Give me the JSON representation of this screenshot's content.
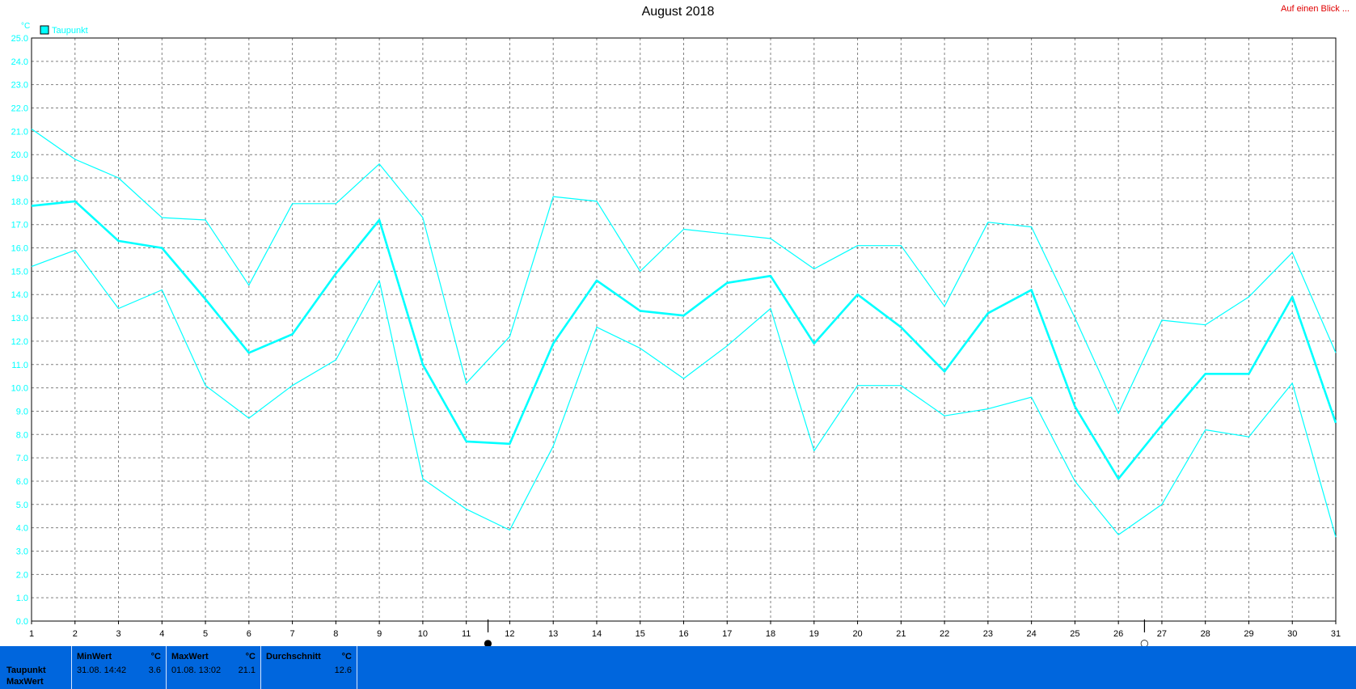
{
  "header": {
    "title": "August 2018",
    "link": "Auf einen Blick ..."
  },
  "chart_data": {
    "type": "line",
    "title": "August 2018",
    "ylabel": "°C",
    "xlabel": "",
    "ylim": [
      0,
      25
    ],
    "y_ticks": [
      "0.0",
      "1.0",
      "2.0",
      "3.0",
      "4.0",
      "5.0",
      "6.0",
      "7.0",
      "8.0",
      "9.0",
      "10.0",
      "11.0",
      "12.0",
      "13.0",
      "14.0",
      "15.0",
      "16.0",
      "17.0",
      "18.0",
      "19.0",
      "20.0",
      "21.0",
      "22.0",
      "23.0",
      "24.0",
      "25.0"
    ],
    "x": [
      1,
      2,
      3,
      4,
      5,
      6,
      7,
      8,
      9,
      10,
      11,
      12,
      13,
      14,
      15,
      16,
      17,
      18,
      19,
      20,
      21,
      22,
      23,
      24,
      25,
      26,
      27,
      28,
      29,
      30,
      31
    ],
    "legend": [
      "Taupunkt"
    ],
    "legend_position": "top-left",
    "grid": true,
    "color": "#00ffff",
    "series": [
      {
        "name": "Taupunkt",
        "role": "max",
        "values": [
          21.1,
          19.8,
          19.0,
          17.3,
          17.2,
          14.4,
          17.9,
          17.9,
          19.6,
          17.3,
          10.2,
          12.2,
          18.2,
          18.0,
          15.0,
          16.8,
          16.6,
          16.4,
          15.1,
          16.1,
          16.1,
          13.5,
          17.1,
          16.9,
          13.0,
          8.9,
          12.9,
          12.7,
          13.9,
          15.8,
          11.5
        ]
      },
      {
        "name": "Taupunkt",
        "role": "avg",
        "values": [
          17.8,
          18.0,
          16.3,
          16.0,
          13.8,
          11.5,
          12.3,
          14.9,
          17.2,
          11.0,
          7.7,
          7.6,
          11.9,
          14.6,
          13.3,
          13.1,
          14.5,
          14.8,
          11.9,
          14.0,
          12.6,
          10.7,
          13.2,
          14.2,
          9.2,
          6.1,
          8.4,
          10.6,
          10.6,
          13.9,
          8.5
        ]
      },
      {
        "name": "Taupunkt",
        "role": "min",
        "values": [
          15.2,
          15.9,
          13.4,
          14.2,
          10.1,
          8.7,
          10.1,
          11.2,
          14.6,
          6.1,
          4.8,
          3.9,
          7.5,
          12.6,
          11.7,
          10.4,
          11.8,
          13.4,
          7.3,
          10.1,
          10.1,
          8.8,
          9.1,
          9.6,
          6.0,
          3.7,
          5.0,
          8.2,
          7.9,
          10.2,
          3.6
        ]
      }
    ],
    "moon_phase_markers": [
      {
        "day": 11.5,
        "symbol": "●"
      },
      {
        "day": 26.6,
        "symbol": "○"
      }
    ]
  },
  "stats": {
    "row_labels": [
      "Taupunkt",
      "MaxWert"
    ],
    "min": {
      "header": "MinWert",
      "unit": "°C",
      "when": "31.08.  14:42",
      "value": "3.6"
    },
    "max": {
      "header": "MaxWert",
      "unit": "°C",
      "when": "01.08.  13:02",
      "value": "21.1"
    },
    "avg": {
      "header": "Durchschnitt",
      "unit": "°C",
      "value": "12.6"
    }
  }
}
